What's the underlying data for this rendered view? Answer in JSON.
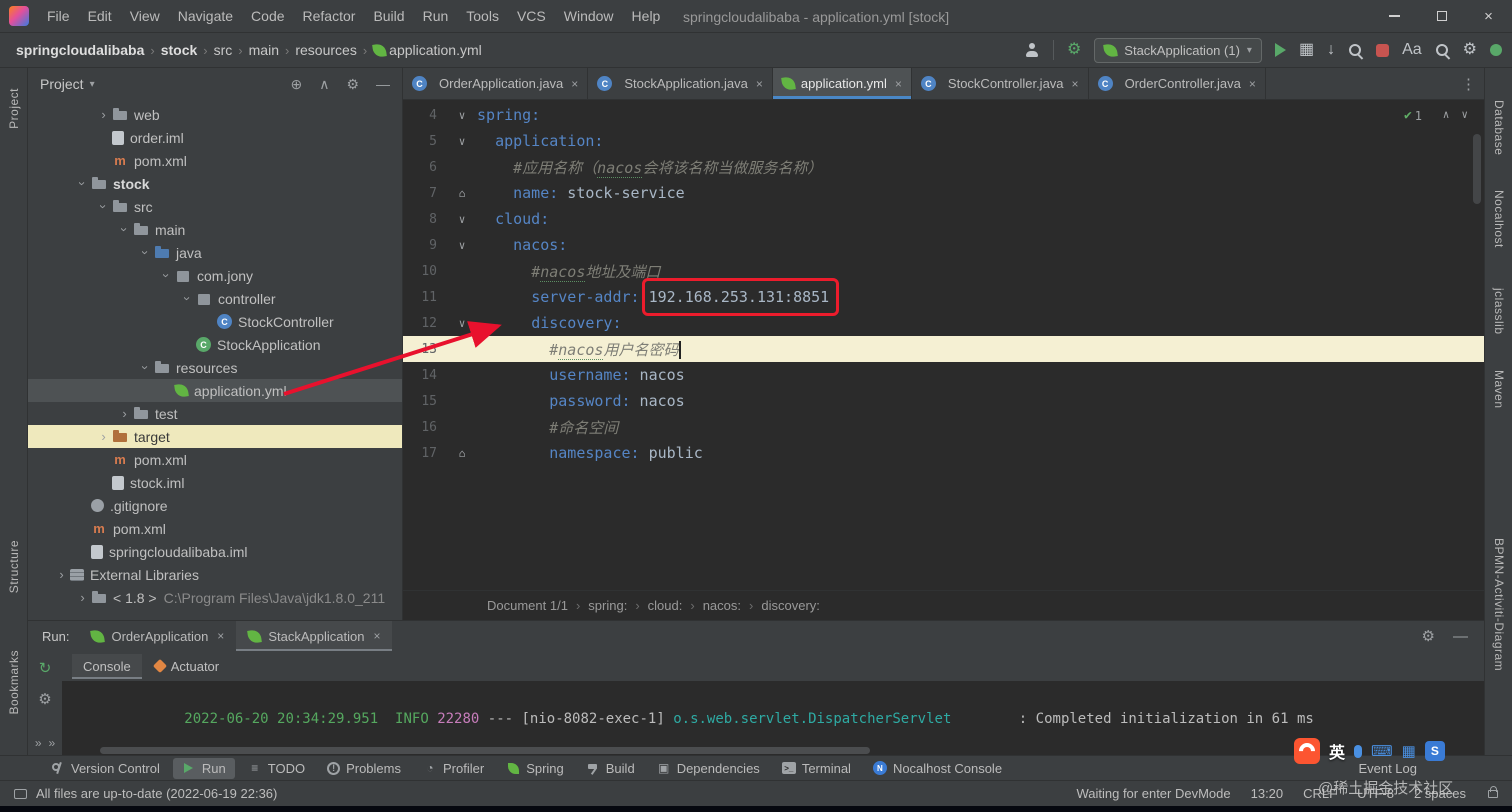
{
  "colors": {
    "accent_red": "#e8112d",
    "key_blue": "#5585c5",
    "value_gray": "#a9b7c6",
    "comment_gray": "#7e7e76",
    "log_green": "#55A85F",
    "log_magenta": "#C77DBB",
    "log_teal": "#2EAAA3",
    "spring_green": "#62b543",
    "run_green": "#59A869"
  },
  "titlebar": {
    "menus": [
      "File",
      "Edit",
      "View",
      "Navigate",
      "Code",
      "Refactor",
      "Build",
      "Run",
      "Tools",
      "VCS",
      "Window",
      "Help"
    ],
    "title": "springcloudalibaba - application.yml [stock]"
  },
  "toolbar": {
    "breadcrumbs": [
      "springcloudalibaba",
      "stock",
      "src",
      "main",
      "resources",
      "application.yml"
    ],
    "run_config": "StackApplication (1)",
    "right_icons": [
      "user-icon",
      "divider",
      "nocalhost-dev-icon",
      "run-config-select",
      "run-button",
      "services-icon",
      "coverage-icon",
      "search-history-icon",
      "stop-button",
      "translate-icon",
      "search-everywhere-icon",
      "settings-icon",
      "notifications-icon"
    ]
  },
  "strips": {
    "left": [
      "Project",
      "Structure",
      "Bookmarks"
    ],
    "right": [
      "Database",
      "Nocalhost",
      "jclasslib",
      "Maven",
      "BPMN-Activiti-Diagram"
    ]
  },
  "project": {
    "title": "Project",
    "header_icons": [
      "locate-icon",
      "collapse-all-icon",
      "settings-icon",
      "hide-icon"
    ],
    "tree": [
      {
        "label": "web",
        "icon": "folder",
        "depth": 3,
        "chevron": "collapsed"
      },
      {
        "label": "order.iml",
        "icon": "iml",
        "depth": 3
      },
      {
        "label": "pom.xml",
        "icon": "maven",
        "depth": 3
      },
      {
        "label": "stock",
        "icon": "folder",
        "depth": 2,
        "chevron": "expanded",
        "bold": true
      },
      {
        "label": "src",
        "icon": "folder",
        "depth": 3,
        "chevron": "expanded"
      },
      {
        "label": "main",
        "icon": "folder",
        "depth": 4,
        "chevron": "expanded"
      },
      {
        "label": "java",
        "icon": "folder-source",
        "depth": 5,
        "chevron": "expanded"
      },
      {
        "label": "com.jony",
        "icon": "package",
        "depth": 6,
        "chevron": "expanded"
      },
      {
        "label": "controller",
        "icon": "package",
        "depth": 7,
        "chevron": "expanded"
      },
      {
        "label": "StockController",
        "icon": "class",
        "depth": 8
      },
      {
        "label": "StockApplication",
        "icon": "class-main",
        "depth": 7
      },
      {
        "label": "resources",
        "icon": "folder-resources",
        "depth": 5,
        "chevron": "expanded"
      },
      {
        "label": "application.yml",
        "icon": "spring",
        "depth": 6,
        "selected": true
      },
      {
        "label": "test",
        "icon": "folder",
        "depth": 4,
        "chevron": "collapsed"
      },
      {
        "label": "target",
        "icon": "folder-excluded",
        "depth": 3,
        "chevron": "collapsed",
        "flagged": true
      },
      {
        "label": "pom.xml",
        "icon": "maven",
        "depth": 3
      },
      {
        "label": "stock.iml",
        "icon": "iml",
        "depth": 3
      },
      {
        "label": ".gitignore",
        "icon": "gitignore",
        "depth": 2
      },
      {
        "label": "pom.xml",
        "icon": "maven",
        "depth": 2
      },
      {
        "label": "springcloudalibaba.iml",
        "icon": "iml",
        "depth": 2
      },
      {
        "label": "External Libraries",
        "icon": "libraries",
        "depth": 1,
        "chevron": "collapsed"
      },
      {
        "label": "< 1.8 >",
        "sub": "C:\\Program Files\\Java\\jdk1.8.0_211",
        "icon": "jdk",
        "depth": 2,
        "chevron": "collapsed"
      }
    ]
  },
  "editor": {
    "tabs": [
      {
        "label": "OrderApplication.java",
        "icon": "class"
      },
      {
        "label": "StockApplication.java",
        "icon": "class"
      },
      {
        "label": "application.yml",
        "icon": "spring",
        "active": true
      },
      {
        "label": "StockController.java",
        "icon": "class"
      },
      {
        "label": "OrderController.java",
        "icon": "class"
      }
    ],
    "inspection_count": "1",
    "lines": [
      {
        "n": 4,
        "g": "fold",
        "seg": [
          {
            "t": "spring:",
            "s": "key"
          }
        ]
      },
      {
        "n": 5,
        "g": "fold",
        "seg": [
          {
            "t": "  ",
            "s": "plain"
          },
          {
            "t": "application:",
            "s": "key"
          }
        ]
      },
      {
        "n": 6,
        "g": "",
        "seg": [
          {
            "t": "    ",
            "s": "plain"
          },
          {
            "t": "#应用名称（",
            "s": "comment"
          },
          {
            "t": "nacos",
            "s": "comment-u"
          },
          {
            "t": "会将该名称当做服务名称）",
            "s": "comment"
          }
        ]
      },
      {
        "n": 7,
        "g": "mark",
        "seg": [
          {
            "t": "    ",
            "s": "plain"
          },
          {
            "t": "name:",
            "s": "key"
          },
          {
            "t": " stock-service",
            "s": "value"
          }
        ]
      },
      {
        "n": 8,
        "g": "fold",
        "seg": [
          {
            "t": "  ",
            "s": "plain"
          },
          {
            "t": "cloud:",
            "s": "key"
          }
        ]
      },
      {
        "n": 9,
        "g": "fold",
        "seg": [
          {
            "t": "    ",
            "s": "plain"
          },
          {
            "t": "nacos:",
            "s": "key"
          }
        ]
      },
      {
        "n": 10,
        "g": "",
        "seg": [
          {
            "t": "      ",
            "s": "plain"
          },
          {
            "t": "#",
            "s": "comment"
          },
          {
            "t": "nacos",
            "s": "comment-u"
          },
          {
            "t": "地址及端口",
            "s": "comment"
          }
        ]
      },
      {
        "n": 11,
        "g": "",
        "seg": [
          {
            "t": "      ",
            "s": "plain"
          },
          {
            "t": "server-addr: ",
            "s": "key"
          },
          {
            "t": "192.168.253.131:8851",
            "s": "value",
            "boxed": true
          }
        ]
      },
      {
        "n": 12,
        "g": "fold",
        "seg": [
          {
            "t": "      ",
            "s": "plain"
          },
          {
            "t": "discovery:",
            "s": "key"
          }
        ]
      },
      {
        "n": 13,
        "g": "",
        "hl": true,
        "cursor": true,
        "seg": [
          {
            "t": "        ",
            "s": "plain"
          },
          {
            "t": "#",
            "s": "comment"
          },
          {
            "t": "nacos",
            "s": "comment-u"
          },
          {
            "t": "用户名密码",
            "s": "comment"
          }
        ]
      },
      {
        "n": 14,
        "g": "",
        "seg": [
          {
            "t": "        ",
            "s": "plain"
          },
          {
            "t": "username:",
            "s": "key"
          },
          {
            "t": " nacos",
            "s": "value"
          }
        ]
      },
      {
        "n": 15,
        "g": "",
        "seg": [
          {
            "t": "        ",
            "s": "plain"
          },
          {
            "t": "password:",
            "s": "key"
          },
          {
            "t": " nacos",
            "s": "value"
          }
        ]
      },
      {
        "n": 16,
        "g": "",
        "seg": [
          {
            "t": "        ",
            "s": "plain"
          },
          {
            "t": "#命名空间",
            "s": "comment"
          }
        ]
      },
      {
        "n": 17,
        "g": "mark",
        "seg": [
          {
            "t": "        ",
            "s": "plain"
          },
          {
            "t": "namespace:",
            "s": "key"
          },
          {
            "t": " public",
            "s": "value"
          }
        ]
      }
    ],
    "breadcrumb": [
      "Document 1/1",
      "spring:",
      "cloud:",
      "nacos:",
      "discovery:"
    ]
  },
  "run_panel": {
    "label": "Run:",
    "tabs": [
      {
        "label": "OrderApplication"
      },
      {
        "label": "StackApplication",
        "active": true
      }
    ],
    "subtabs": [
      {
        "label": "Console",
        "active": true
      },
      {
        "label": "Actuator",
        "icon": "actuator-icon"
      }
    ],
    "tool_icons": [
      "rerun-icon",
      "wrench-icon"
    ],
    "console": [
      {
        "t": "2022-06-20 20:34:29.951",
        "c": "green"
      },
      {
        "t": "  ",
        "c": "plain"
      },
      {
        "t": "INFO",
        "c": "green"
      },
      {
        "t": " ",
        "c": "plain"
      },
      {
        "t": "22280",
        "c": "magenta"
      },
      {
        "t": " --- [nio-8082-exec-1] ",
        "c": "plain"
      },
      {
        "t": "o.s.web.servlet.DispatcherServlet",
        "c": "teal"
      },
      {
        "t": "        : Completed initialization in 61 ms",
        "c": "plain"
      }
    ]
  },
  "bottom_bar": {
    "items": [
      {
        "label": "Version Control",
        "icon": "branch-icon"
      },
      {
        "label": "Run",
        "icon": "run-icon",
        "active": true
      },
      {
        "label": "TODO",
        "icon": "todo-icon"
      },
      {
        "label": "Problems",
        "icon": "problems-icon"
      },
      {
        "label": "Profiler",
        "icon": "profiler-icon"
      },
      {
        "label": "Spring",
        "icon": "spring-icon"
      },
      {
        "label": "Build",
        "icon": "build-icon"
      },
      {
        "label": "Dependencies",
        "icon": "dependencies-icon"
      },
      {
        "label": "Terminal",
        "icon": "terminal-icon"
      },
      {
        "label": "Nocalhost Console",
        "icon": "nocalhost-icon"
      }
    ],
    "right_label": "Event Log"
  },
  "status_bar": {
    "left": "All files are up-to-date (2022-06-19 22:36)",
    "right": [
      "Waiting for enter DevMode",
      "13:20",
      "CRLF",
      "UTF-8",
      "2 spaces"
    ]
  },
  "overlay": {
    "watermark": "@稀土掘金技术社区",
    "ime_lang": "英"
  }
}
